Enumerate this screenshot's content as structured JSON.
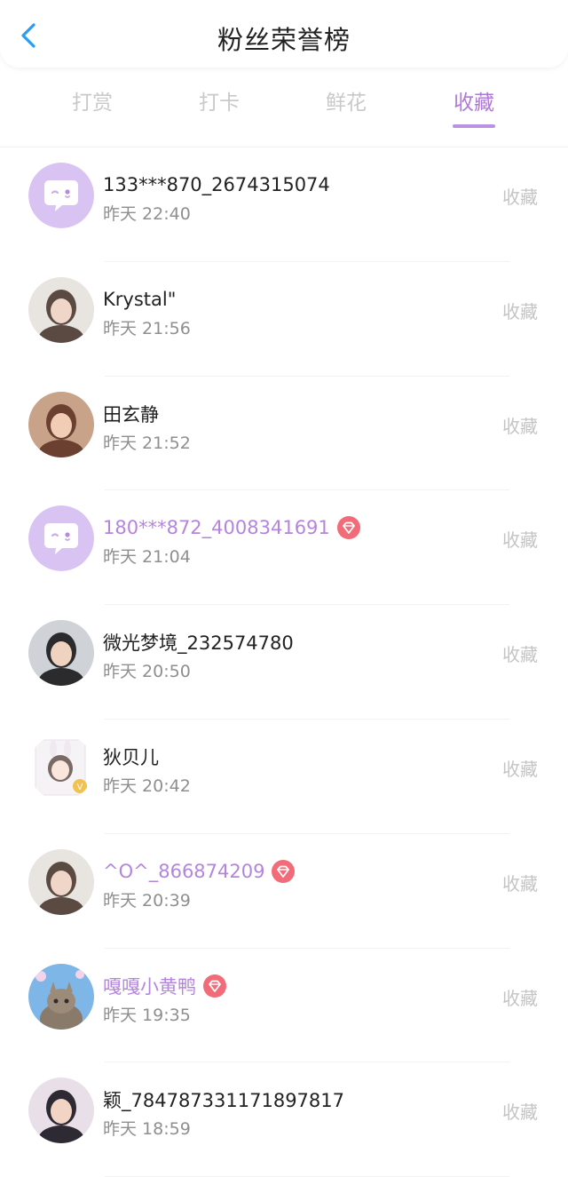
{
  "header": {
    "title": "粉丝荣誉榜",
    "back_icon": "chevron-left-icon",
    "back_color": "#2a9df4"
  },
  "tabs": [
    {
      "label": "打赏",
      "active": false
    },
    {
      "label": "打卡",
      "active": false
    },
    {
      "label": "鲜花",
      "active": false
    },
    {
      "label": "收藏",
      "active": true
    }
  ],
  "accent_color": "#b485dd",
  "fans": [
    {
      "name": "133***870_2674315074",
      "time": "昨天 22:40",
      "action": "收藏",
      "vip": false,
      "avatar": "default-chat-avatar"
    },
    {
      "name": "Krystal\"",
      "time": "昨天 21:56",
      "action": "收藏",
      "vip": false,
      "avatar": "photo-avatar"
    },
    {
      "name": "田玄静",
      "time": "昨天 21:52",
      "action": "收藏",
      "vip": false,
      "avatar": "photo-avatar"
    },
    {
      "name": "180***872_4008341691",
      "time": "昨天 21:04",
      "action": "收藏",
      "vip": true,
      "avatar": "default-chat-avatar"
    },
    {
      "name": "微光梦境_232574780",
      "time": "昨天 20:50",
      "action": "收藏",
      "vip": false,
      "avatar": "photo-avatar"
    },
    {
      "name": "狄贝儿",
      "time": "昨天 20:42",
      "action": "收藏",
      "vip": false,
      "avatar": "cartoon-avatar"
    },
    {
      "name": "^O^_866874209",
      "time": "昨天 20:39",
      "action": "收藏",
      "vip": true,
      "avatar": "photo-avatar"
    },
    {
      "name": "嘎嘎小黄鸭",
      "time": "昨天 19:35",
      "action": "收藏",
      "vip": true,
      "avatar": "cat-photo-avatar"
    },
    {
      "name": "颖_784787331171897817",
      "time": "昨天 18:59",
      "action": "收藏",
      "vip": false,
      "avatar": "photo-avatar"
    }
  ]
}
